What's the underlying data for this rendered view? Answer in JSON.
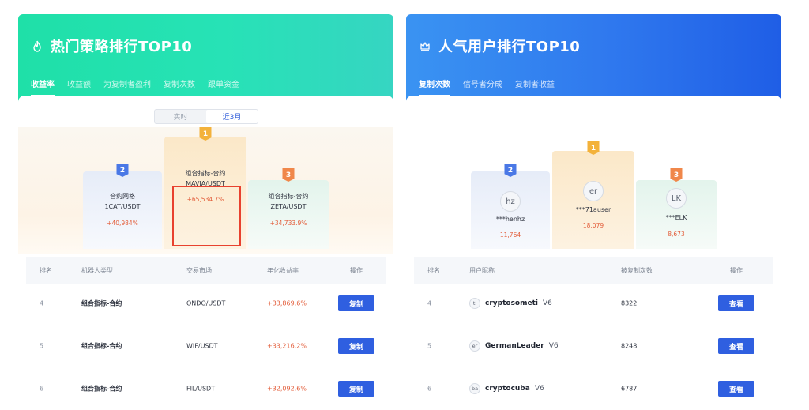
{
  "left": {
    "title": "热门策略排行TOP10",
    "icon": "flame-icon",
    "tabs": [
      "收益率",
      "收益额",
      "为复制者盈利",
      "复制次数",
      "跟单资金"
    ],
    "segment": [
      "实时",
      "近3月"
    ],
    "podium": {
      "second": {
        "rank": "2",
        "name": "合约网格",
        "pair": "1CAT/USDT",
        "value": "+40,984%"
      },
      "first": {
        "rank": "1",
        "name": "组合指标-合约",
        "pair": "MAVIA/USDT",
        "value": "+65,534.7%"
      },
      "third": {
        "rank": "3",
        "name": "组合指标-合约",
        "pair": "ZETA/USDT",
        "value": "+34,733.9%"
      }
    },
    "table": {
      "headers": [
        "排名",
        "机器人类型",
        "交易市场",
        "年化收益率",
        "操作"
      ],
      "rows": [
        {
          "rank": "4",
          "type": "组合指标-合约",
          "market": "ONDO/USDT",
          "yield": "+33,869.6%",
          "action": "复制"
        },
        {
          "rank": "5",
          "type": "组合指标-合约",
          "market": "WIF/USDT",
          "yield": "+33,216.2%",
          "action": "复制"
        },
        {
          "rank": "6",
          "type": "组合指标-合约",
          "market": "FIL/USDT",
          "yield": "+32,092.6%",
          "action": "复制"
        }
      ]
    }
  },
  "right": {
    "title": "人气用户排行TOP10",
    "icon": "crown-icon",
    "tabs": [
      "复制次数",
      "信号者分成",
      "复制者收益"
    ],
    "podium": {
      "second": {
        "rank": "2",
        "avatar": "hz",
        "name": "***henhz",
        "value": "11,764"
      },
      "first": {
        "rank": "1",
        "avatar": "er",
        "name": "***71auser",
        "value": "18,079"
      },
      "third": {
        "rank": "3",
        "avatar": "LK",
        "name": "***ELK",
        "value": "8,673"
      }
    },
    "table": {
      "headers": [
        "排名",
        "用户昵称",
        "被复制次数",
        "操作"
      ],
      "rows": [
        {
          "rank": "4",
          "avatar": "ti",
          "name": "cryptosometi",
          "badge": "V6",
          "count": "8322",
          "action": "查看"
        },
        {
          "rank": "5",
          "avatar": "er",
          "name": "GermanLeader",
          "badge": "V6",
          "count": "8248",
          "action": "查看"
        },
        {
          "rank": "6",
          "avatar": "ba",
          "name": "cryptocuba",
          "badge": "V6",
          "count": "6787",
          "action": "查看"
        }
      ]
    }
  },
  "colors": {
    "left_header": "#27e2b6",
    "right_header": "#2f78ee",
    "button": "#2f5fe0",
    "gain": "#e35d3a",
    "highlight": "#e8412f"
  }
}
